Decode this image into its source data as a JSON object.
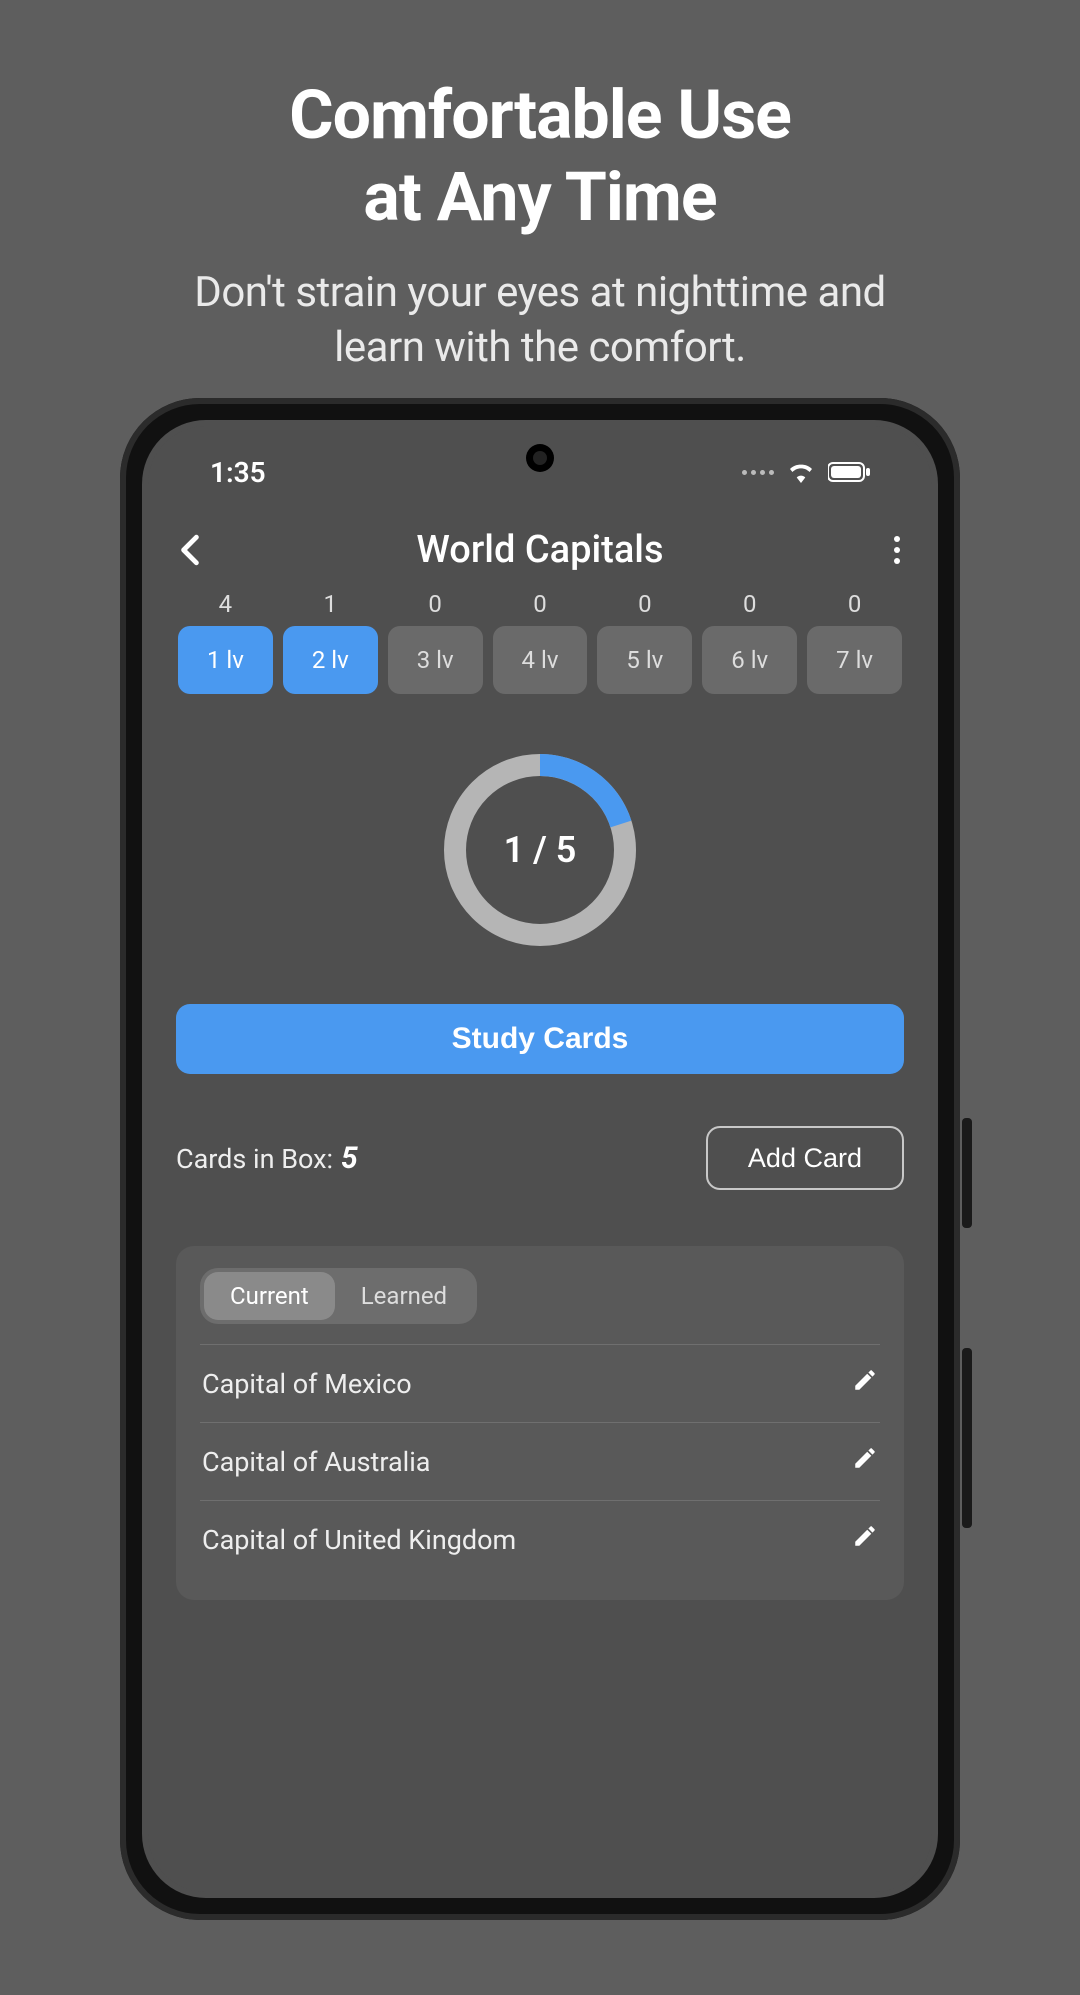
{
  "promo": {
    "title_line1": "Comfortable Use",
    "title_line2": "at Any Time",
    "subtitle_line1": "Don't strain your eyes at nighttime and",
    "subtitle_line2": "learn with the comfort."
  },
  "status": {
    "time": "1:35"
  },
  "header": {
    "title": "World Capitals"
  },
  "levels": [
    {
      "count": "4",
      "label": "1 lv",
      "active": true
    },
    {
      "count": "1",
      "label": "2 lv",
      "active": true
    },
    {
      "count": "0",
      "label": "3 lv",
      "active": false
    },
    {
      "count": "0",
      "label": "4 lv",
      "active": false
    },
    {
      "count": "0",
      "label": "5 lv",
      "active": false
    },
    {
      "count": "0",
      "label": "6 lv",
      "active": false
    },
    {
      "count": "0",
      "label": "7 lv",
      "active": false
    }
  ],
  "progress": {
    "text": "1 / 5",
    "percent": 20
  },
  "actions": {
    "study_label": "Study Cards",
    "add_label": "Add Card"
  },
  "box": {
    "label": "Cards in Box:",
    "count": "5"
  },
  "tabs": {
    "current": "Current",
    "learned": "Learned"
  },
  "cards": [
    {
      "title": "Capital of Mexico"
    },
    {
      "title": "Capital of Australia"
    },
    {
      "title": "Capital of United Kingdom"
    }
  ]
}
